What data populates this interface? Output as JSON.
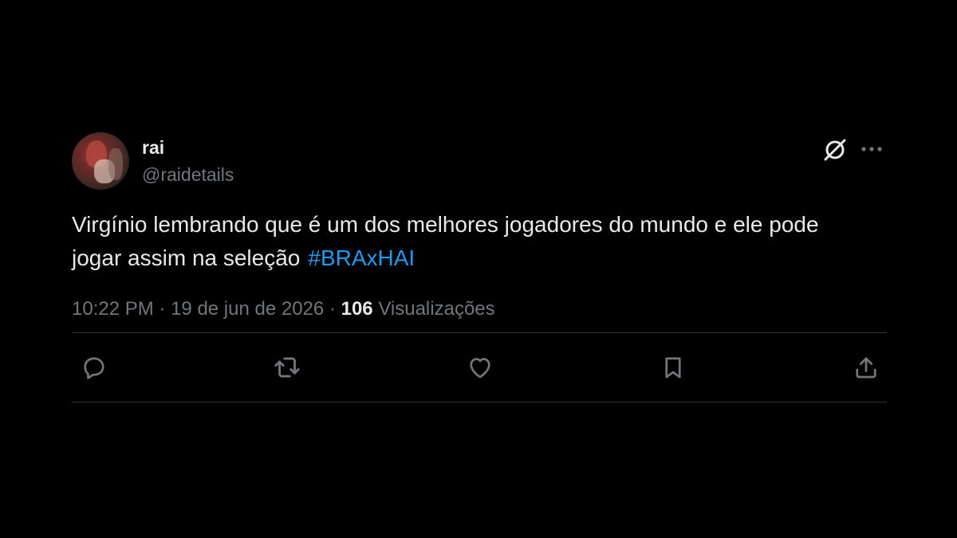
{
  "author": {
    "display_name": "rai",
    "handle": "@raidetails",
    "avatar_icon": "avatar-photo"
  },
  "header_actions": {
    "grok_icon": "grok-icon",
    "more_icon": "more-icon"
  },
  "tweet": {
    "text": "Virgínio lembrando que é um dos melhores jogadores do mundo e ele pode jogar assim na seleção",
    "hashtag": "#BRAxHAI",
    "time": "10:22 PM",
    "separator": "·",
    "date": "19 de jun de 2026",
    "views_count": "106",
    "views_label": "Visualizações"
  },
  "actions": [
    {
      "name": "reply",
      "icon": "reply-icon"
    },
    {
      "name": "retweet",
      "icon": "retweet-icon"
    },
    {
      "name": "like",
      "icon": "heart-icon"
    },
    {
      "name": "bookmark",
      "icon": "bookmark-icon"
    },
    {
      "name": "share",
      "icon": "share-icon"
    }
  ],
  "colors": {
    "background": "#000000",
    "text": "#e7e9ea",
    "secondary": "#71767b",
    "link": "#1d9bf0",
    "divider": "#2f3336"
  }
}
